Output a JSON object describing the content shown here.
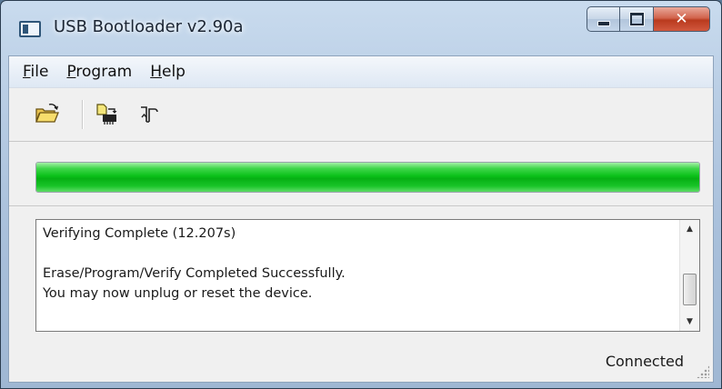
{
  "window": {
    "title": "USB Bootloader v2.90a",
    "caption_buttons": {
      "minimize": "minimize",
      "maximize": "maximize",
      "close": "✕"
    }
  },
  "menu": {
    "items": [
      {
        "accel": "F",
        "rest": "ile"
      },
      {
        "accel": "P",
        "rest": "rogram"
      },
      {
        "accel": "H",
        "rest": "elp"
      }
    ]
  },
  "toolbar": {
    "buttons": [
      "open-folder-icon",
      "program-device-icon",
      "reset-device-icon"
    ]
  },
  "progress": {
    "fraction": 1.0,
    "color": "#0cc21a"
  },
  "log": {
    "lines": [
      "Verifying Complete (12.207s)",
      "",
      "Erase/Program/Verify Completed Successfully.",
      "You may now unplug or reset the device."
    ]
  },
  "status": {
    "text": "Connected"
  }
}
